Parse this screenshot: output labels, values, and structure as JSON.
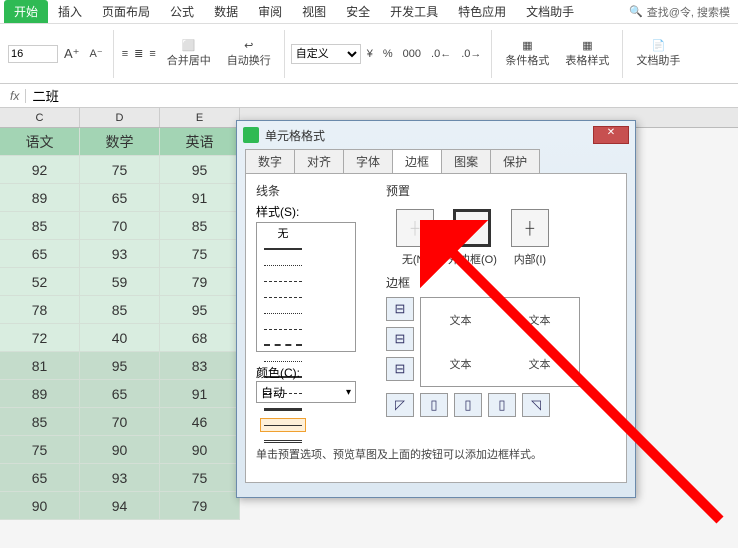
{
  "ribbon": {
    "tabs": [
      "开始",
      "插入",
      "页面布局",
      "公式",
      "数据",
      "审阅",
      "视图",
      "安全",
      "开发工具",
      "特色应用",
      "文档助手"
    ],
    "active_tab": 0,
    "search_placeholder": "查找@令, 搜索模",
    "font_size": "16",
    "merge_label": "合并居中",
    "wrap_label": "自动换行",
    "number_format": "自定义",
    "cond_fmt_label": "条件格式",
    "table_style_label": "表格样式",
    "doc_helper_label": "文档助手",
    "currency_sym": "¥",
    "percent_sym": "%"
  },
  "formula_bar": {
    "label": "fx",
    "value": "二班"
  },
  "columns": [
    "C",
    "D",
    "E"
  ],
  "header_row": [
    "语文",
    "数学",
    "英语"
  ],
  "rows": [
    [
      "92",
      "75",
      "95"
    ],
    [
      "89",
      "65",
      "91"
    ],
    [
      "85",
      "70",
      "85"
    ],
    [
      "65",
      "93",
      "75"
    ],
    [
      "52",
      "59",
      "79"
    ],
    [
      "78",
      "85",
      "95"
    ],
    [
      "72",
      "40",
      "68"
    ],
    [
      "81",
      "95",
      "83"
    ],
    [
      "89",
      "65",
      "91"
    ],
    [
      "85",
      "70",
      "46"
    ],
    [
      "75",
      "90",
      "90"
    ],
    [
      "65",
      "93",
      "75"
    ],
    [
      "90",
      "94",
      "79"
    ]
  ],
  "selected_end": 7,
  "dialog": {
    "title": "单元格格式",
    "tabs": [
      "数字",
      "对齐",
      "字体",
      "边框",
      "图案",
      "保护"
    ],
    "active_tab": 3,
    "line_section": "线条",
    "style_label": "样式(S):",
    "none_label": "无",
    "color_label": "颜色(C):",
    "color_value": "自动",
    "preset_section": "预置",
    "preset_none": "无(N)",
    "preset_outline": "外边框(O)",
    "preset_inside": "内部(I)",
    "border_section": "边框",
    "preview_text": "文本",
    "hint": "单击预置选项、预览草图及上面的按钮可以添加边框样式。"
  }
}
